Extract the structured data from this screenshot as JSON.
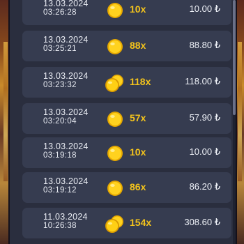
{
  "history": {
    "currency_symbol": "₺",
    "rows": [
      {
        "date": "13.03.2024",
        "time": "03:26:28",
        "multiplier": "10x",
        "payout": "10.00 ₺",
        "coins": "single-coin"
      },
      {
        "date": "13.03.2024",
        "time": "03:25:21",
        "multiplier": "88x",
        "payout": "88.80 ₺",
        "coins": "single-coin"
      },
      {
        "date": "13.03.2024",
        "time": "03:23:32",
        "multiplier": "118x",
        "payout": "118.00 ₺",
        "coins": "stacked-coins"
      },
      {
        "date": "13.03.2024",
        "time": "03:20:04",
        "multiplier": "57x",
        "payout": "57.90 ₺",
        "coins": "single-coin"
      },
      {
        "date": "13.03.2024",
        "time": "03:19:18",
        "multiplier": "10x",
        "payout": "10.00 ₺",
        "coins": "single-coin"
      },
      {
        "date": "13.03.2024",
        "time": "03:19:12",
        "multiplier": "86x",
        "payout": "86.20 ₺",
        "coins": "single-coin"
      },
      {
        "date": "11.03.2024",
        "time": "10:26:38",
        "multiplier": "154x",
        "payout": "308.60 ₺",
        "coins": "stacked-coins"
      }
    ]
  },
  "colors": {
    "panel_background": "#2a2e3e",
    "row_background": "#363c50",
    "multiplier_gold": "#f3c31c",
    "text_light": "#e9ecf3"
  }
}
